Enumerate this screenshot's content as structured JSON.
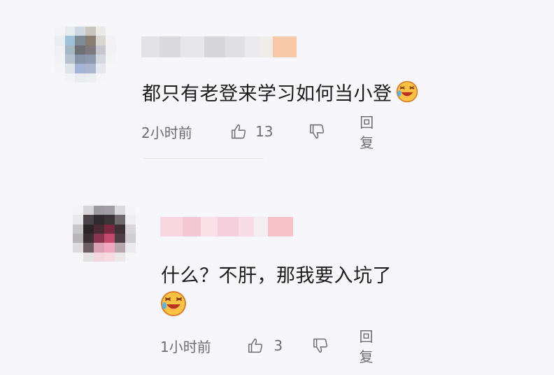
{
  "comments": [
    {
      "text": "都只有老登来学习如何当小登",
      "time": "2小时前",
      "likes": "13",
      "reply_label": "回复",
      "emoji_icon": "laughing-emoji-icon"
    },
    {
      "text": "什么？不肝，那我要入坑了",
      "time": "1小时前",
      "likes": "3",
      "reply_label": "回复",
      "emoji_icon": "laughing-emoji-icon"
    }
  ],
  "colors": {
    "background": "#f7f7fb",
    "text": "#1c1c1c",
    "meta": "#6c6c74"
  }
}
